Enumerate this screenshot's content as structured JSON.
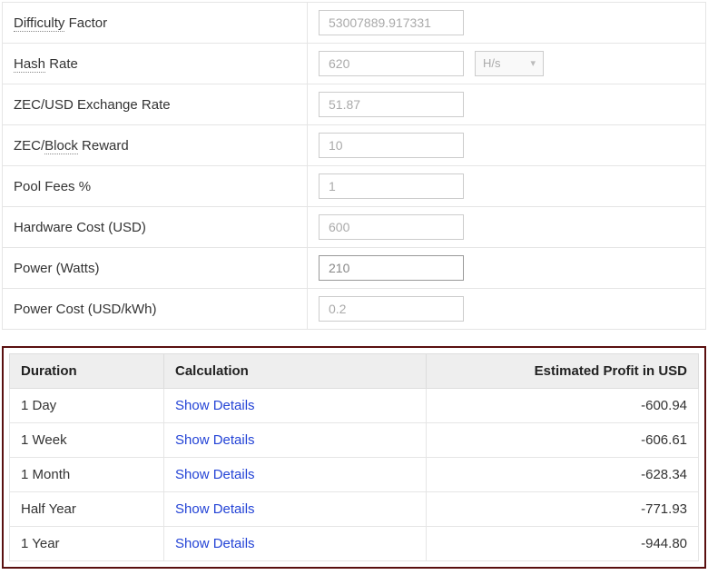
{
  "form": {
    "rows": [
      {
        "label_html": "<span class=\"dotted\">Difficulty</span> Factor",
        "value": "53007889.917331",
        "has_unit": false,
        "active": false
      },
      {
        "label_html": "<span class=\"dotted\">Hash</span> Rate",
        "value": "620",
        "has_unit": true,
        "unit": "H/s",
        "active": false
      },
      {
        "label_html": "ZEC/USD Exchange Rate",
        "value": "51.87",
        "has_unit": false,
        "active": false
      },
      {
        "label_html": "ZEC/<span class=\"dotted\">Block</span> Reward",
        "value": "10",
        "has_unit": false,
        "active": false
      },
      {
        "label_html": "Pool Fees %",
        "value": "1",
        "has_unit": false,
        "active": false
      },
      {
        "label_html": "Hardware Cost (USD)",
        "value": "600",
        "has_unit": false,
        "active": false
      },
      {
        "label_html": "Power (Watts)",
        "value": "210",
        "has_unit": false,
        "active": true
      },
      {
        "label_html": "Power Cost (USD/kWh)",
        "value": "0.2",
        "has_unit": false,
        "active": false
      }
    ]
  },
  "results": {
    "headers": {
      "duration": "Duration",
      "calculation": "Calculation",
      "profit": "Estimated Profit in USD"
    },
    "link_label": "Show Details",
    "rows": [
      {
        "duration": "1 Day",
        "profit": "-600.94"
      },
      {
        "duration": "1 Week",
        "profit": "-606.61"
      },
      {
        "duration": "1 Month",
        "profit": "-628.34"
      },
      {
        "duration": "Half Year",
        "profit": "-771.93"
      },
      {
        "duration": "1 Year",
        "profit": "-944.80"
      }
    ]
  }
}
